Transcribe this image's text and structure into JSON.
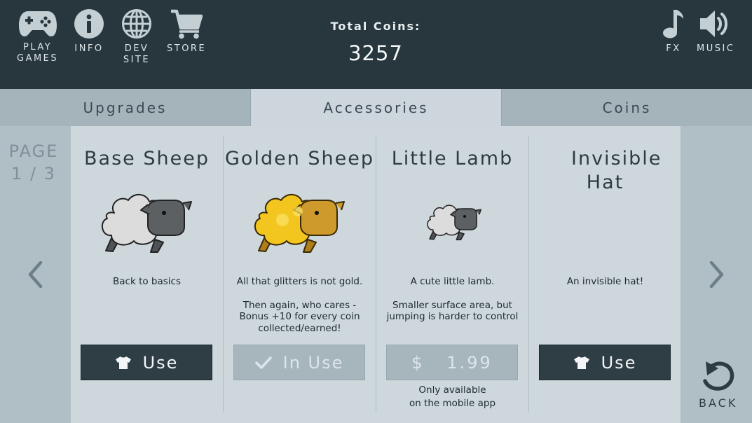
{
  "topbar": {
    "nav": [
      {
        "label": "PLAY\nGAMES",
        "icon": "gamepad-icon"
      },
      {
        "label": "INFO",
        "icon": "info-icon"
      },
      {
        "label": "DEV\nSITE",
        "icon": "globe-icon"
      },
      {
        "label": "STORE",
        "icon": "cart-icon"
      }
    ],
    "coins_title": "Total Coins:",
    "coins_value": "3257",
    "fx_label": "FX",
    "music_label": "MUSIC"
  },
  "tabs": [
    {
      "label": "Upgrades",
      "active": false
    },
    {
      "label": "Accessories",
      "active": true
    },
    {
      "label": "Coins",
      "active": false
    }
  ],
  "pager": {
    "label": "PAGE",
    "value": "1 / 3"
  },
  "items": [
    {
      "name": "Base Sheep",
      "desc1": "Back to basics",
      "desc2": "",
      "button": "Use",
      "state": "use"
    },
    {
      "name": "Golden Sheep",
      "desc1": "All that glitters is not gold.",
      "desc2": "Then again, who cares - Bonus +10 for every coin collected/earned!",
      "button": "In Use",
      "state": "inuse"
    },
    {
      "name": "Little Lamb",
      "desc1": "A cute little lamb.",
      "desc2": "Smaller surface area, but jumping is harder to control",
      "button": "$   1.99",
      "state": "price",
      "note1": "Only available",
      "note2": "on the mobile app"
    },
    {
      "name": "Invisible Hat",
      "desc1": "An invisible hat!",
      "desc2": "",
      "button": "Use",
      "state": "use"
    }
  ],
  "back_label": "BACK",
  "colors": {
    "topbar": "#28373e",
    "panel": "#cdd7dc",
    "tab_active": "#ccd6dc",
    "tab_inactive": "#a5b4bb",
    "button_dark": "#2f3e45",
    "gold": "#e8b21e"
  }
}
